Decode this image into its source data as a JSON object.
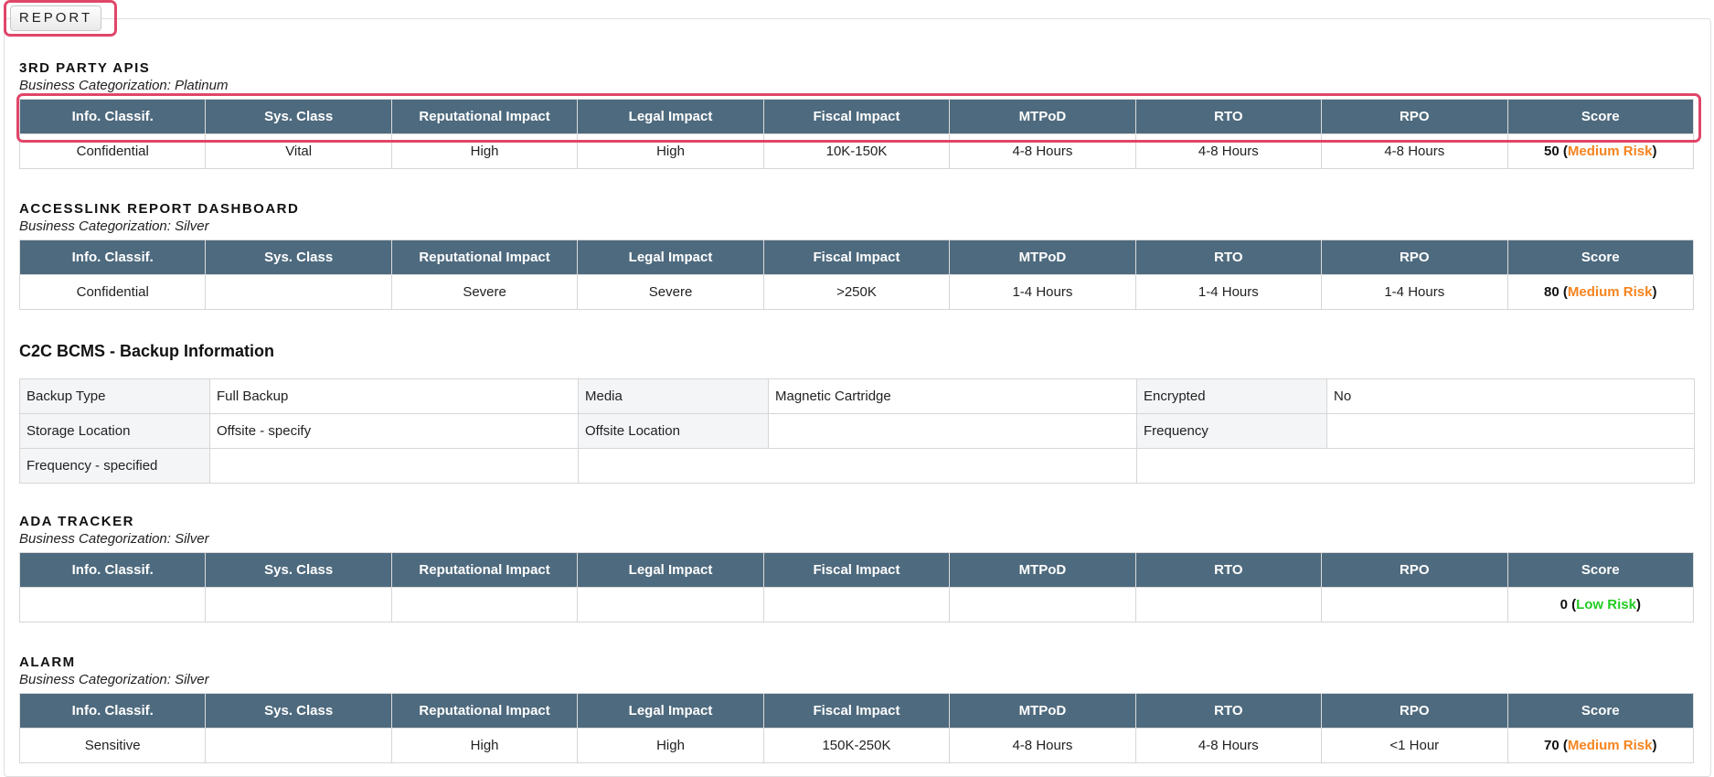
{
  "report_tab": "REPORT",
  "columns": [
    "Info. Classif.",
    "Sys. Class",
    "Reputational Impact",
    "Legal Impact",
    "Fiscal Impact",
    "MTPoD",
    "RTO",
    "RPO",
    "Score"
  ],
  "sections": [
    {
      "title": "3RD PARTY APIS",
      "categorization": "Business Categorization: Platinum",
      "row": [
        "Confidential",
        "Vital",
        "High",
        "High",
        "10K-150K",
        "4-8 Hours",
        "4-8 Hours",
        "4-8 Hours"
      ],
      "score": "50",
      "risk": "Medium Risk",
      "risk_color": "#f5841f"
    },
    {
      "title": "ACCESSLINK REPORT DASHBOARD",
      "categorization": "Business Categorization: Silver",
      "row": [
        "Confidential",
        "",
        "Severe",
        "Severe",
        ">250K",
        "1-4 Hours",
        "1-4 Hours",
        "1-4 Hours"
      ],
      "score": "80",
      "risk": "Medium Risk",
      "risk_color": "#f5841f"
    },
    {
      "title": "ADA TRACKER",
      "categorization": "Business Categorization: Silver",
      "row": [
        "",
        "",
        "",
        "",
        "",
        "",
        "",
        ""
      ],
      "score": "0",
      "risk": "Low Risk",
      "risk_color": "#22cc22"
    },
    {
      "title": "ALARM",
      "categorization": "Business Categorization: Silver",
      "row": [
        "Sensitive",
        "",
        "High",
        "High",
        "150K-250K",
        "4-8 Hours",
        "4-8 Hours",
        "<1 Hour"
      ],
      "score": "70",
      "risk": "Medium Risk",
      "risk_color": "#f5841f"
    }
  ],
  "backup": {
    "title": "C2C BCMS - Backup Information",
    "rows": [
      [
        {
          "label": "Backup Type",
          "value": "Full Backup"
        },
        {
          "label": "Media",
          "value": "Magnetic Cartridge"
        },
        {
          "label": "Encrypted",
          "value": "No"
        }
      ],
      [
        {
          "label": "Storage Location",
          "value": "Offsite - specify"
        },
        {
          "label": "Offsite Location",
          "value": ""
        },
        {
          "label": "Frequency",
          "value": ""
        }
      ]
    ],
    "last_row_label": "Frequency - specified"
  }
}
